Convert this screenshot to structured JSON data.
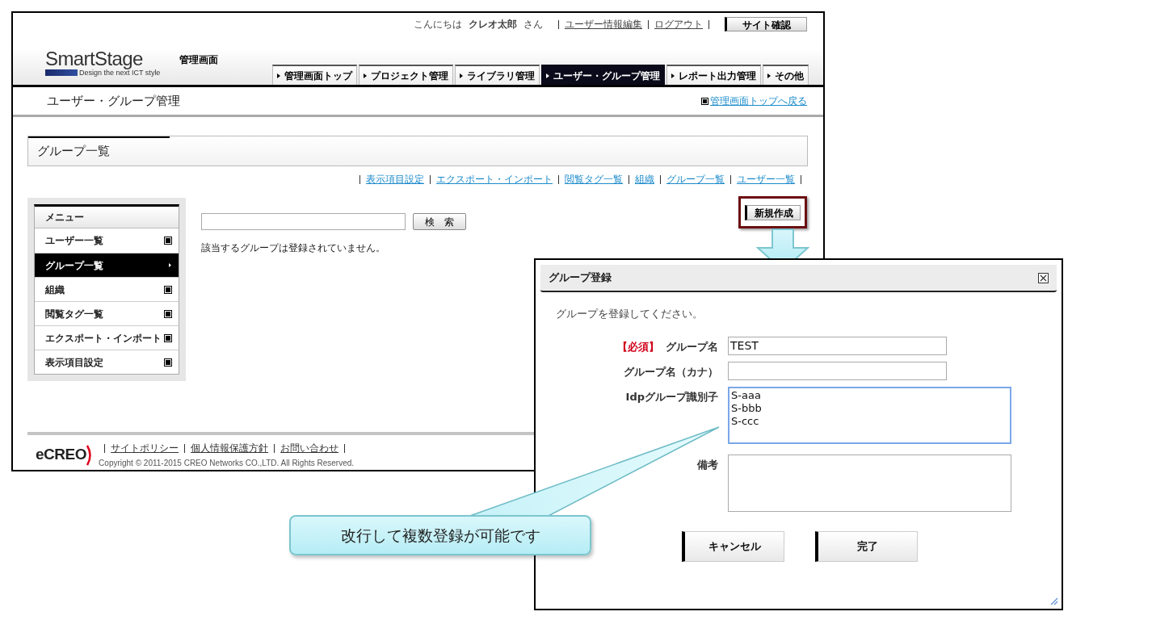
{
  "header": {
    "greeting": "こんにちは",
    "user_name": "クレオ太郎",
    "honorific": "さん",
    "links": [
      "ユーザー情報編集",
      "ログアウト"
    ],
    "site_button": "サイト確認",
    "logo": "SmartStage",
    "logo_tagline": "Design the next ICT style",
    "subtitle": "管理画面"
  },
  "nav_tabs": [
    {
      "label": "管理画面トップ",
      "selected": false
    },
    {
      "label": "プロジェクト管理",
      "selected": false
    },
    {
      "label": "ライブラリ管理",
      "selected": false
    },
    {
      "label": "ユーザー・グループ管理",
      "selected": true
    },
    {
      "label": "レポート出力管理",
      "selected": false
    },
    {
      "label": "その他",
      "selected": false
    }
  ],
  "page_title": "ユーザー・グループ管理",
  "back_link": "管理画面トップへ戻る",
  "section_title": "グループ一覧",
  "sub_links": [
    "表示項目設定",
    "エクスポート・インポート",
    "閲覧タグ一覧",
    "組織",
    "グループ一覧",
    "ユーザー一覧"
  ],
  "new_button": "新規作成",
  "menu": {
    "title": "メニュー",
    "items": [
      {
        "label": "ユーザー一覧",
        "selected": false
      },
      {
        "label": "グループ一覧",
        "selected": true
      },
      {
        "label": "組織",
        "selected": false
      },
      {
        "label": "閲覧タグ一覧",
        "selected": false
      },
      {
        "label": "エクスポート・インポート",
        "selected": false
      },
      {
        "label": "表示項目設定",
        "selected": false
      }
    ]
  },
  "search": {
    "button": "検　索"
  },
  "empty_message": "該当するグループは登録されていません。",
  "footer": {
    "logo": "eCREO",
    "links": [
      "サイトポリシー",
      "個人情報保護方針",
      "お問い合わせ"
    ],
    "copyright": "Copyright © 2011-2015 CREO Networks CO.,LTD. All Rights Reserved."
  },
  "dialog": {
    "title": "グループ登録",
    "instruction": "グループを登録してください。",
    "fields": [
      {
        "kind": "input",
        "required_mark": "【必須】",
        "label": "グループ名",
        "value": "TEST",
        "focused": false
      },
      {
        "kind": "input",
        "label": "グループ名（カナ）",
        "focused": false
      },
      {
        "kind": "textarea",
        "label": "Idpグループ識別子",
        "value": "S-aaa\nS-bbb\nS-ccc",
        "focused": true
      },
      {
        "kind": "textarea",
        "label": "備考",
        "focused": false
      }
    ],
    "buttons": [
      "キャンセル",
      "完了"
    ]
  },
  "callout": "改行して複数登録が可能です"
}
